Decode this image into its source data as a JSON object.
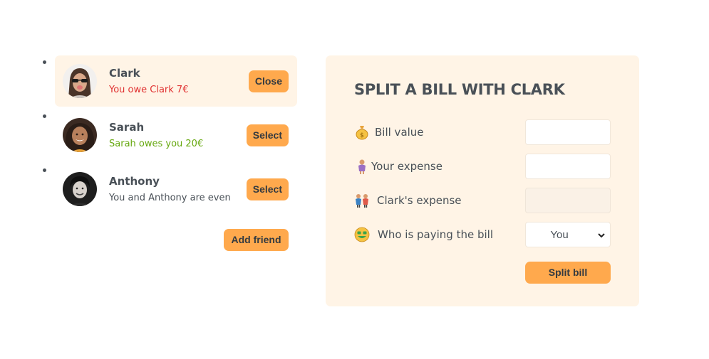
{
  "friends": [
    {
      "name": "Clark",
      "status": "You owe Clark 7€",
      "button": "Close"
    },
    {
      "name": "Sarah",
      "status": "Sarah owes you 20€",
      "button": "Select"
    },
    {
      "name": "Anthony",
      "status": "You and Anthony are even",
      "button": "Select"
    }
  ],
  "add_friend_label": "Add friend",
  "split_form": {
    "title": "SPLIT A BILL WITH CLARK",
    "bill_value_label": "Bill value",
    "your_expense_label": "Your expense",
    "friend_expense_label": "Clark's expense",
    "payer_label": "Who is paying the bill",
    "payer_selected": "You",
    "submit_label": "Split bill",
    "icons": [
      "money-bag-icon",
      "person-icon",
      "two-people-icon",
      "money-mouth-face-icon"
    ]
  },
  "colors": {
    "accent": "#ffa94d",
    "panel_bg": "#fff4e6",
    "owe_red": "#e03131",
    "owed_green": "#66a80f",
    "text": "#495057"
  }
}
